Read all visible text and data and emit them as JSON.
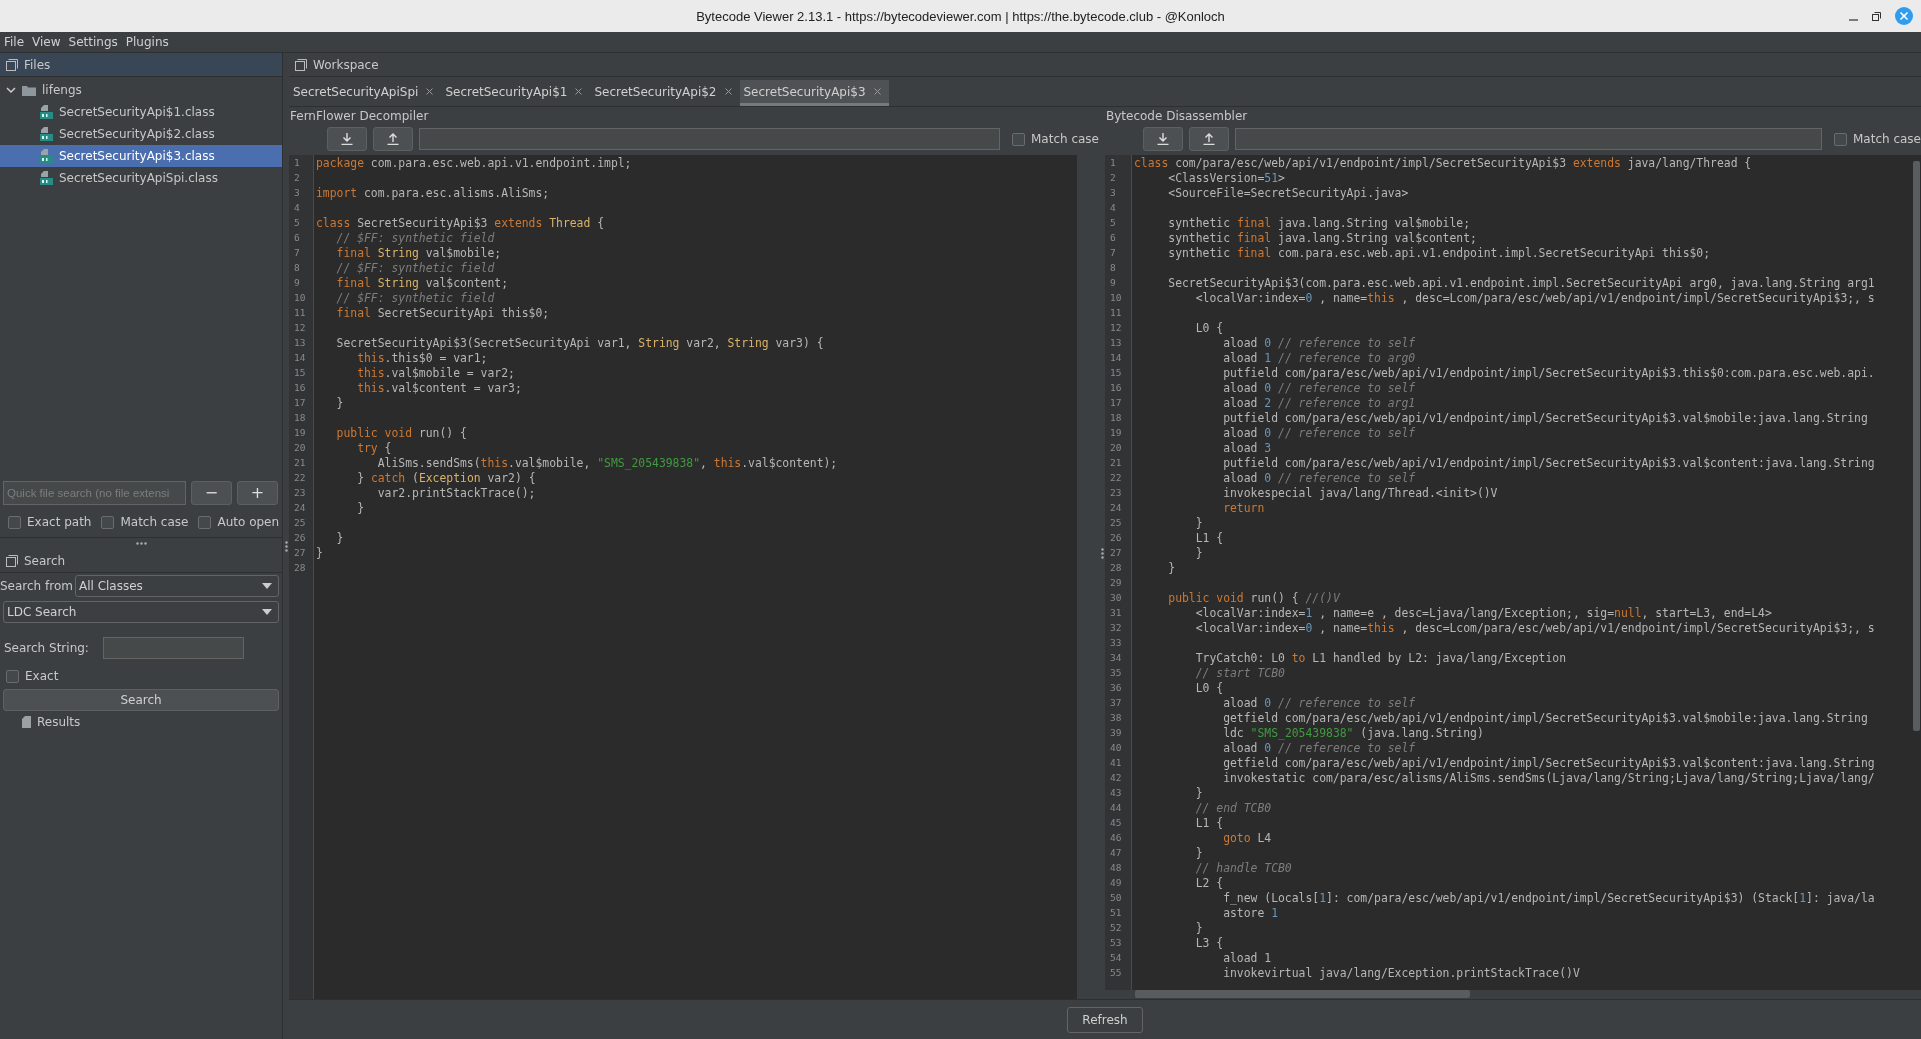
{
  "window": {
    "title": "Bytecode Viewer 2.13.1 - https://bytecodeviewer.com | https://the.bytecode.club - @Konloch"
  },
  "menu": [
    "File",
    "View",
    "Settings",
    "Plugins"
  ],
  "files_panel": {
    "title": "Files",
    "tree": [
      {
        "label": "lifengs",
        "expanded": true,
        "selected": false,
        "children": [
          {
            "label": "SecretSecurityApi$1.class",
            "selected": false
          },
          {
            "label": "SecretSecurityApi$2.class",
            "selected": false
          },
          {
            "label": "SecretSecurityApi$3.class",
            "selected": true
          },
          {
            "label": "SecretSecurityApiSpi.class",
            "selected": false
          }
        ]
      }
    ],
    "quick_search": {
      "placeholder": "Quick file search (no file extensi"
    },
    "buttons": [
      "−",
      "+"
    ],
    "options": [
      {
        "label": "Exact path",
        "checked": false
      },
      {
        "label": "Match case",
        "checked": false
      },
      {
        "label": "Auto open",
        "checked": false
      }
    ]
  },
  "search_panel": {
    "title": "Search",
    "search_from": {
      "label": "Search from",
      "value": "All Classes"
    },
    "mode": {
      "value": "LDC Search"
    },
    "search_string": {
      "label": "Search String:"
    },
    "exact": {
      "label": "Exact",
      "checked": false
    },
    "button": "Search",
    "results": "Results"
  },
  "workspace": {
    "title": "Workspace",
    "tabs": [
      {
        "label": "SecretSecurityApiSpi",
        "selected": false
      },
      {
        "label": "SecretSecurityApi$1",
        "selected": false
      },
      {
        "label": "SecretSecurityApi$2",
        "selected": false
      },
      {
        "label": "SecretSecurityApi$3",
        "selected": true
      }
    ],
    "panes": [
      {
        "title": "FernFlower Decompiler",
        "match_case": {
          "label": "Match case",
          "checked": false
        },
        "lines": [
          {
            "n": "1",
            "tokens": [
              {
                "kind": "kw",
                "text": "package"
              },
              {
                "kind": "tx",
                "text": " com.para.esc.web.api.v1.endpoint.impl;"
              }
            ]
          },
          {
            "n": "2"
          },
          {
            "n": "3",
            "tokens": [
              {
                "kind": "kw",
                "text": "import"
              },
              {
                "kind": "tx",
                "text": " com.para.esc.alisms.AliSms;"
              }
            ]
          },
          {
            "n": "4"
          },
          {
            "n": "5",
            "tokens": [
              {
                "kind": "kw",
                "text": "class"
              },
              {
                "kind": "tx",
                "text": " SecretSecurityApi$3 "
              },
              {
                "kind": "kw",
                "text": "extends"
              },
              {
                "kind": "type",
                "text": " Thread"
              },
              {
                "kind": "tx",
                "text": " {"
              }
            ]
          },
          {
            "n": "6",
            "tokens": [
              {
                "kind": "cm",
                "text": "   // $FF: synthetic field"
              }
            ]
          },
          {
            "n": "7",
            "tokens": [
              {
                "kind": "kw",
                "text": "   final"
              },
              {
                "kind": "type",
                "text": " String"
              },
              {
                "kind": "tx",
                "text": " val$mobile;"
              }
            ]
          },
          {
            "n": "8",
            "tokens": [
              {
                "kind": "cm",
                "text": "   // $FF: synthetic field"
              }
            ]
          },
          {
            "n": "9",
            "tokens": [
              {
                "kind": "kw",
                "text": "   final"
              },
              {
                "kind": "type",
                "text": " String"
              },
              {
                "kind": "tx",
                "text": " val$content;"
              }
            ]
          },
          {
            "n": "10",
            "tokens": [
              {
                "kind": "cm",
                "text": "   // $FF: synthetic field"
              }
            ]
          },
          {
            "n": "11",
            "tokens": [
              {
                "kind": "kw",
                "text": "   final"
              },
              {
                "kind": "tx",
                "text": " SecretSecurityApi this$0;"
              }
            ]
          },
          {
            "n": "12"
          },
          {
            "n": "13",
            "tokens": [
              {
                "kind": "tx",
                "text": "   SecretSecurityApi$3(SecretSecurityApi var1, "
              },
              {
                "kind": "type",
                "text": "String"
              },
              {
                "kind": "tx",
                "text": " var2, "
              },
              {
                "kind": "type",
                "text": "String"
              },
              {
                "kind": "tx",
                "text": " var3) {"
              }
            ]
          },
          {
            "n": "14",
            "tokens": [
              {
                "kind": "kw",
                "text": "      this"
              },
              {
                "kind": "tx",
                "text": ".this$0 = var1;"
              }
            ]
          },
          {
            "n": "15",
            "tokens": [
              {
                "kind": "kw",
                "text": "      this"
              },
              {
                "kind": "tx",
                "text": ".val$mobile = var2;"
              }
            ]
          },
          {
            "n": "16",
            "tokens": [
              {
                "kind": "kw",
                "text": "      this"
              },
              {
                "kind": "tx",
                "text": ".val$content = var3;"
              }
            ]
          },
          {
            "n": "17",
            "tokens": [
              {
                "kind": "tx",
                "text": "   }"
              }
            ]
          },
          {
            "n": "18"
          },
          {
            "n": "19",
            "tokens": [
              {
                "kind": "kw",
                "text": "   public"
              },
              {
                "kind": "kw",
                "text": " void"
              },
              {
                "kind": "tx",
                "text": " run() {"
              }
            ]
          },
          {
            "n": "20",
            "tokens": [
              {
                "kind": "kw",
                "text": "      try"
              },
              {
                "kind": "tx",
                "text": " {"
              }
            ]
          },
          {
            "n": "21",
            "tokens": [
              {
                "kind": "tx",
                "text": "         AliSms.sendSms("
              },
              {
                "kind": "kw",
                "text": "this"
              },
              {
                "kind": "tx",
                "text": ".val$mobile, "
              },
              {
                "kind": "str",
                "text": "\"SMS_205439838\""
              },
              {
                "kind": "tx",
                "text": ", "
              },
              {
                "kind": "kw",
                "text": "this"
              },
              {
                "kind": "tx",
                "text": ".val$content);"
              }
            ]
          },
          {
            "n": "22",
            "tokens": [
              {
                "kind": "tx",
                "text": "      } "
              },
              {
                "kind": "kw",
                "text": "catch"
              },
              {
                "kind": "tx",
                "text": " ("
              },
              {
                "kind": "type",
                "text": "Exception"
              },
              {
                "kind": "tx",
                "text": " var2) {"
              }
            ]
          },
          {
            "n": "23",
            "tokens": [
              {
                "kind": "tx",
                "text": "         var2.printStackTrace();"
              }
            ]
          },
          {
            "n": "24",
            "tokens": [
              {
                "kind": "tx",
                "text": "      }"
              }
            ]
          },
          {
            "n": "25"
          },
          {
            "n": "26",
            "tokens": [
              {
                "kind": "tx",
                "text": "   }"
              }
            ]
          },
          {
            "n": "27",
            "tokens": [
              {
                "kind": "tx",
                "text": "}"
              }
            ]
          },
          {
            "n": "28"
          }
        ]
      },
      {
        "title": "Bytecode Disassembler",
        "match_case": {
          "label": "Match case",
          "checked": false
        },
        "lines": [
          {
            "n": "1",
            "tokens": [
              {
                "kind": "kw",
                "text": "class"
              },
              {
                "kind": "tx",
                "text": " com/para/esc/web/api/v1/endpoint/impl/SecretSecurityApi$3 "
              },
              {
                "kind": "kw",
                "text": "extends"
              },
              {
                "kind": "tx",
                "text": " java/lang/Thread {"
              }
            ]
          },
          {
            "n": "2",
            "tokens": [
              {
                "kind": "tx",
                "text": "     <ClassVersion="
              },
              {
                "kind": "num",
                "text": "51"
              },
              {
                "kind": "tx",
                "text": ">"
              }
            ]
          },
          {
            "n": "3",
            "tokens": [
              {
                "kind": "tx",
                "text": "     <SourceFile=SecretSecurityApi.java>"
              }
            ]
          },
          {
            "n": "4"
          },
          {
            "n": "5",
            "tokens": [
              {
                "kind": "tx",
                "text": "     synthetic "
              },
              {
                "kind": "kw",
                "text": "final"
              },
              {
                "kind": "tx",
                "text": " java.lang.String val$mobile;"
              }
            ]
          },
          {
            "n": "6",
            "tokens": [
              {
                "kind": "tx",
                "text": "     synthetic "
              },
              {
                "kind": "kw",
                "text": "final"
              },
              {
                "kind": "tx",
                "text": " java.lang.String val$content;"
              }
            ]
          },
          {
            "n": "7",
            "tokens": [
              {
                "kind": "tx",
                "text": "     synthetic "
              },
              {
                "kind": "kw",
                "text": "final"
              },
              {
                "kind": "tx",
                "text": " com.para.esc.web.api.v1.endpoint.impl.SecretSecurityApi this$0;"
              }
            ]
          },
          {
            "n": "8"
          },
          {
            "n": "9",
            "tokens": [
              {
                "kind": "tx",
                "text": "     SecretSecurityApi$3(com.para.esc.web.api.v1.endpoint.impl.SecretSecurityApi arg0, java.lang.String arg1"
              }
            ]
          },
          {
            "n": "10",
            "tokens": [
              {
                "kind": "tx",
                "text": "         <localVar:index="
              },
              {
                "kind": "num",
                "text": "0"
              },
              {
                "kind": "tx",
                "text": " , name="
              },
              {
                "kind": "kw",
                "text": "this"
              },
              {
                "kind": "tx",
                "text": " , desc=Lcom/para/esc/web/api/v1/endpoint/impl/SecretSecurityApi$3;, s"
              }
            ]
          },
          {
            "n": "11"
          },
          {
            "n": "12",
            "tokens": [
              {
                "kind": "tx",
                "text": "         L0 {"
              }
            ]
          },
          {
            "n": "13",
            "tokens": [
              {
                "kind": "tx",
                "text": "             aload "
              },
              {
                "kind": "num",
                "text": "0"
              },
              {
                "kind": "cm",
                "text": " // reference to self"
              }
            ]
          },
          {
            "n": "14",
            "tokens": [
              {
                "kind": "tx",
                "text": "             aload "
              },
              {
                "kind": "num",
                "text": "1"
              },
              {
                "kind": "cm",
                "text": " // reference to arg0"
              }
            ]
          },
          {
            "n": "15",
            "tokens": [
              {
                "kind": "tx",
                "text": "             putfield com/para/esc/web/api/v1/endpoint/impl/SecretSecurityApi$3.this$0:com.para.esc.web.api."
              }
            ]
          },
          {
            "n": "16",
            "tokens": [
              {
                "kind": "tx",
                "text": "             aload "
              },
              {
                "kind": "num",
                "text": "0"
              },
              {
                "kind": "cm",
                "text": " // reference to self"
              }
            ]
          },
          {
            "n": "17",
            "tokens": [
              {
                "kind": "tx",
                "text": "             aload "
              },
              {
                "kind": "num",
                "text": "2"
              },
              {
                "kind": "cm",
                "text": " // reference to arg1"
              }
            ]
          },
          {
            "n": "18",
            "tokens": [
              {
                "kind": "tx",
                "text": "             putfield com/para/esc/web/api/v1/endpoint/impl/SecretSecurityApi$3.val$mobile:java.lang.String"
              }
            ]
          },
          {
            "n": "19",
            "tokens": [
              {
                "kind": "tx",
                "text": "             aload "
              },
              {
                "kind": "num",
                "text": "0"
              },
              {
                "kind": "cm",
                "text": " // reference to self"
              }
            ]
          },
          {
            "n": "20",
            "tokens": [
              {
                "kind": "tx",
                "text": "             aload "
              },
              {
                "kind": "num",
                "text": "3"
              }
            ]
          },
          {
            "n": "21",
            "tokens": [
              {
                "kind": "tx",
                "text": "             putfield com/para/esc/web/api/v1/endpoint/impl/SecretSecurityApi$3.val$content:java.lang.String"
              }
            ]
          },
          {
            "n": "22",
            "tokens": [
              {
                "kind": "tx",
                "text": "             aload "
              },
              {
                "kind": "num",
                "text": "0"
              },
              {
                "kind": "cm",
                "text": " // reference to self"
              }
            ]
          },
          {
            "n": "23",
            "tokens": [
              {
                "kind": "tx",
                "text": "             invokespecial java/lang/Thread.<init>()V"
              }
            ]
          },
          {
            "n": "24",
            "tokens": [
              {
                "kind": "kw",
                "text": "             return"
              }
            ]
          },
          {
            "n": "25",
            "tokens": [
              {
                "kind": "tx",
                "text": "         }"
              }
            ]
          },
          {
            "n": "26",
            "tokens": [
              {
                "kind": "tx",
                "text": "         L1 {"
              }
            ]
          },
          {
            "n": "27",
            "tokens": [
              {
                "kind": "tx",
                "text": "         }"
              }
            ]
          },
          {
            "n": "28",
            "tokens": [
              {
                "kind": "tx",
                "text": "     }"
              }
            ]
          },
          {
            "n": "29"
          },
          {
            "n": "30",
            "tokens": [
              {
                "kind": "kw",
                "text": "     public"
              },
              {
                "kind": "kw",
                "text": " void"
              },
              {
                "kind": "tx",
                "text": " run() { "
              },
              {
                "kind": "cm",
                "text": "//()V"
              }
            ]
          },
          {
            "n": "31",
            "tokens": [
              {
                "kind": "tx",
                "text": "         <localVar:index="
              },
              {
                "kind": "num",
                "text": "1"
              },
              {
                "kind": "tx",
                "text": " , name=e , desc=Ljava/lang/Exception;, sig="
              },
              {
                "kind": "kw",
                "text": "null"
              },
              {
                "kind": "tx",
                "text": ", start=L3, end=L4>"
              }
            ]
          },
          {
            "n": "32",
            "tokens": [
              {
                "kind": "tx",
                "text": "         <localVar:index="
              },
              {
                "kind": "num",
                "text": "0"
              },
              {
                "kind": "tx",
                "text": " , name="
              },
              {
                "kind": "kw",
                "text": "this"
              },
              {
                "kind": "tx",
                "text": " , desc=Lcom/para/esc/web/api/v1/endpoint/impl/SecretSecurityApi$3;, s"
              }
            ]
          },
          {
            "n": "33"
          },
          {
            "n": "34",
            "tokens": [
              {
                "kind": "tx",
                "text": "         TryCatch0: L0 "
              },
              {
                "kind": "kw",
                "text": "to"
              },
              {
                "kind": "tx",
                "text": " L1 handled by L2: java/lang/Exception"
              }
            ]
          },
          {
            "n": "35",
            "tokens": [
              {
                "kind": "cm",
                "text": "         // start TCB0"
              }
            ]
          },
          {
            "n": "36",
            "tokens": [
              {
                "kind": "tx",
                "text": "         L0 {"
              }
            ]
          },
          {
            "n": "37",
            "tokens": [
              {
                "kind": "tx",
                "text": "             aload "
              },
              {
                "kind": "num",
                "text": "0"
              },
              {
                "kind": "cm",
                "text": " // reference to self"
              }
            ]
          },
          {
            "n": "38",
            "tokens": [
              {
                "kind": "tx",
                "text": "             getfield com/para/esc/web/api/v1/endpoint/impl/SecretSecurityApi$3.val$mobile:java.lang.String"
              }
            ]
          },
          {
            "n": "39",
            "tokens": [
              {
                "kind": "tx",
                "text": "             ldc "
              },
              {
                "kind": "str",
                "text": "\"SMS_205439838\""
              },
              {
                "kind": "tx",
                "text": " (java.lang.String)"
              }
            ]
          },
          {
            "n": "40",
            "tokens": [
              {
                "kind": "tx",
                "text": "             aload "
              },
              {
                "kind": "num",
                "text": "0"
              },
              {
                "kind": "cm",
                "text": " // reference to self"
              }
            ]
          },
          {
            "n": "41",
            "tokens": [
              {
                "kind": "tx",
                "text": "             getfield com/para/esc/web/api/v1/endpoint/impl/SecretSecurityApi$3.val$content:java.lang.String"
              }
            ]
          },
          {
            "n": "42",
            "tokens": [
              {
                "kind": "tx",
                "text": "             invokestatic com/para/esc/alisms/AliSms.sendSms(Ljava/lang/String;Ljava/lang/String;Ljava/lang/"
              }
            ]
          },
          {
            "n": "43",
            "tokens": [
              {
                "kind": "tx",
                "text": "         }"
              }
            ]
          },
          {
            "n": "44",
            "tokens": [
              {
                "kind": "cm",
                "text": "         // end TCB0"
              }
            ]
          },
          {
            "n": "45",
            "tokens": [
              {
                "kind": "tx",
                "text": "         L1 {"
              }
            ]
          },
          {
            "n": "46",
            "tokens": [
              {
                "kind": "kw",
                "text": "             goto"
              },
              {
                "kind": "tx",
                "text": " L4"
              }
            ]
          },
          {
            "n": "47",
            "tokens": [
              {
                "kind": "tx",
                "text": "         }"
              }
            ]
          },
          {
            "n": "48",
            "tokens": [
              {
                "kind": "cm",
                "text": "         // handle TCB0"
              }
            ]
          },
          {
            "n": "49",
            "tokens": [
              {
                "kind": "tx",
                "text": "         L2 {"
              }
            ]
          },
          {
            "n": "50",
            "tokens": [
              {
                "kind": "tx",
                "text": "             f_new (Locals["
              },
              {
                "kind": "num",
                "text": "1"
              },
              {
                "kind": "tx",
                "text": "]: com/para/esc/web/api/v1/endpoint/impl/SecretSecurityApi$3) (Stack["
              },
              {
                "kind": "num",
                "text": "1"
              },
              {
                "kind": "tx",
                "text": "]: java/la"
              }
            ]
          },
          {
            "n": "51",
            "tokens": [
              {
                "kind": "tx",
                "text": "             astore "
              },
              {
                "kind": "num",
                "text": "1"
              }
            ]
          },
          {
            "n": "52",
            "tokens": [
              {
                "kind": "tx",
                "text": "         }"
              }
            ]
          },
          {
            "n": "53",
            "tokens": [
              {
                "kind": "tx",
                "text": "         L3 {"
              }
            ]
          },
          {
            "n": "54",
            "tokens": [
              {
                "kind": "tx",
                "text": "             aload 1"
              }
            ]
          },
          {
            "n": "55",
            "tokens": [
              {
                "kind": "tx",
                "text": "             invokevirtual java/lang/Exception.printStackTrace()V"
              }
            ]
          }
        ]
      }
    ],
    "refresh": "Refresh"
  }
}
